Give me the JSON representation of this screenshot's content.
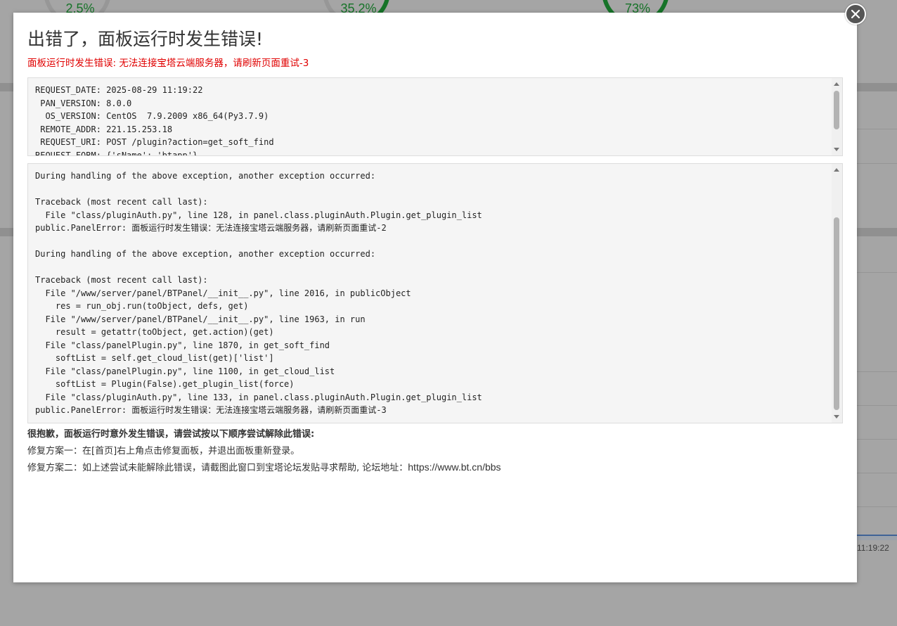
{
  "background": {
    "gauges": [
      {
        "value": "2.5%"
      },
      {
        "value": "35.2%"
      },
      {
        "value": "73%"
      }
    ],
    "chart_time": "11:19:22"
  },
  "dialog": {
    "title": "出错了，面板运行时发生错误!",
    "subtitle": "面板运行时发生错误: 无法连接宝塔云端服务器，请刷新页面重试-3",
    "request_info": "REQUEST_DATE: 2025-08-29 11:19:22\n PAN_VERSION: 8.0.0\n  OS_VERSION: CentOS  7.9.2009 x86_64(Py3.7.9)\n REMOTE_ADDR: 221.15.253.18\n REQUEST_URI: POST /plugin?action=get_soft_find\nREQUEST_FORM: {'sName': 'btapp'}",
    "traceback": "During handling of the above exception, another exception occurred:\n\nTraceback (most recent call last):\n  File \"class/pluginAuth.py\", line 128, in panel.class.pluginAuth.Plugin.get_plugin_list\npublic.PanelError: 面板运行时发生错误：无法连接宝塔云端服务器，请刷新页面重试-2\n\nDuring handling of the above exception, another exception occurred:\n\nTraceback (most recent call last):\n  File \"/www/server/panel/BTPanel/__init__.py\", line 2016, in publicObject\n    res = run_obj.run(toObject, defs, get)\n  File \"/www/server/panel/BTPanel/__init__.py\", line 1963, in run\n    result = getattr(toObject, get.action)(get)\n  File \"class/panelPlugin.py\", line 1870, in get_soft_find\n    softList = self.get_cloud_list(get)['list']\n  File \"class/panelPlugin.py\", line 1100, in get_cloud_list\n    softList = Plugin(False).get_plugin_list(force)\n  File \"class/pluginAuth.py\", line 133, in panel.class.pluginAuth.Plugin.get_plugin_list\npublic.PanelError: 面板运行时发生错误：无法连接宝塔云端服务器，请刷新页面重试-3",
    "help_title": "很抱歉，面板运行时意外发生错误，请尝试按以下顺序尝试解除此错误:",
    "fix_1": "修复方案一：在[首页]右上角点击修复面板，并退出面板重新登录。",
    "fix_2_prefix": "修复方案二：如上述尝试未能解除此错误，请截图此窗口到宝塔论坛发贴寻求帮助, 论坛地址：",
    "fix_2_url": "https://www.bt.cn/bbs"
  }
}
